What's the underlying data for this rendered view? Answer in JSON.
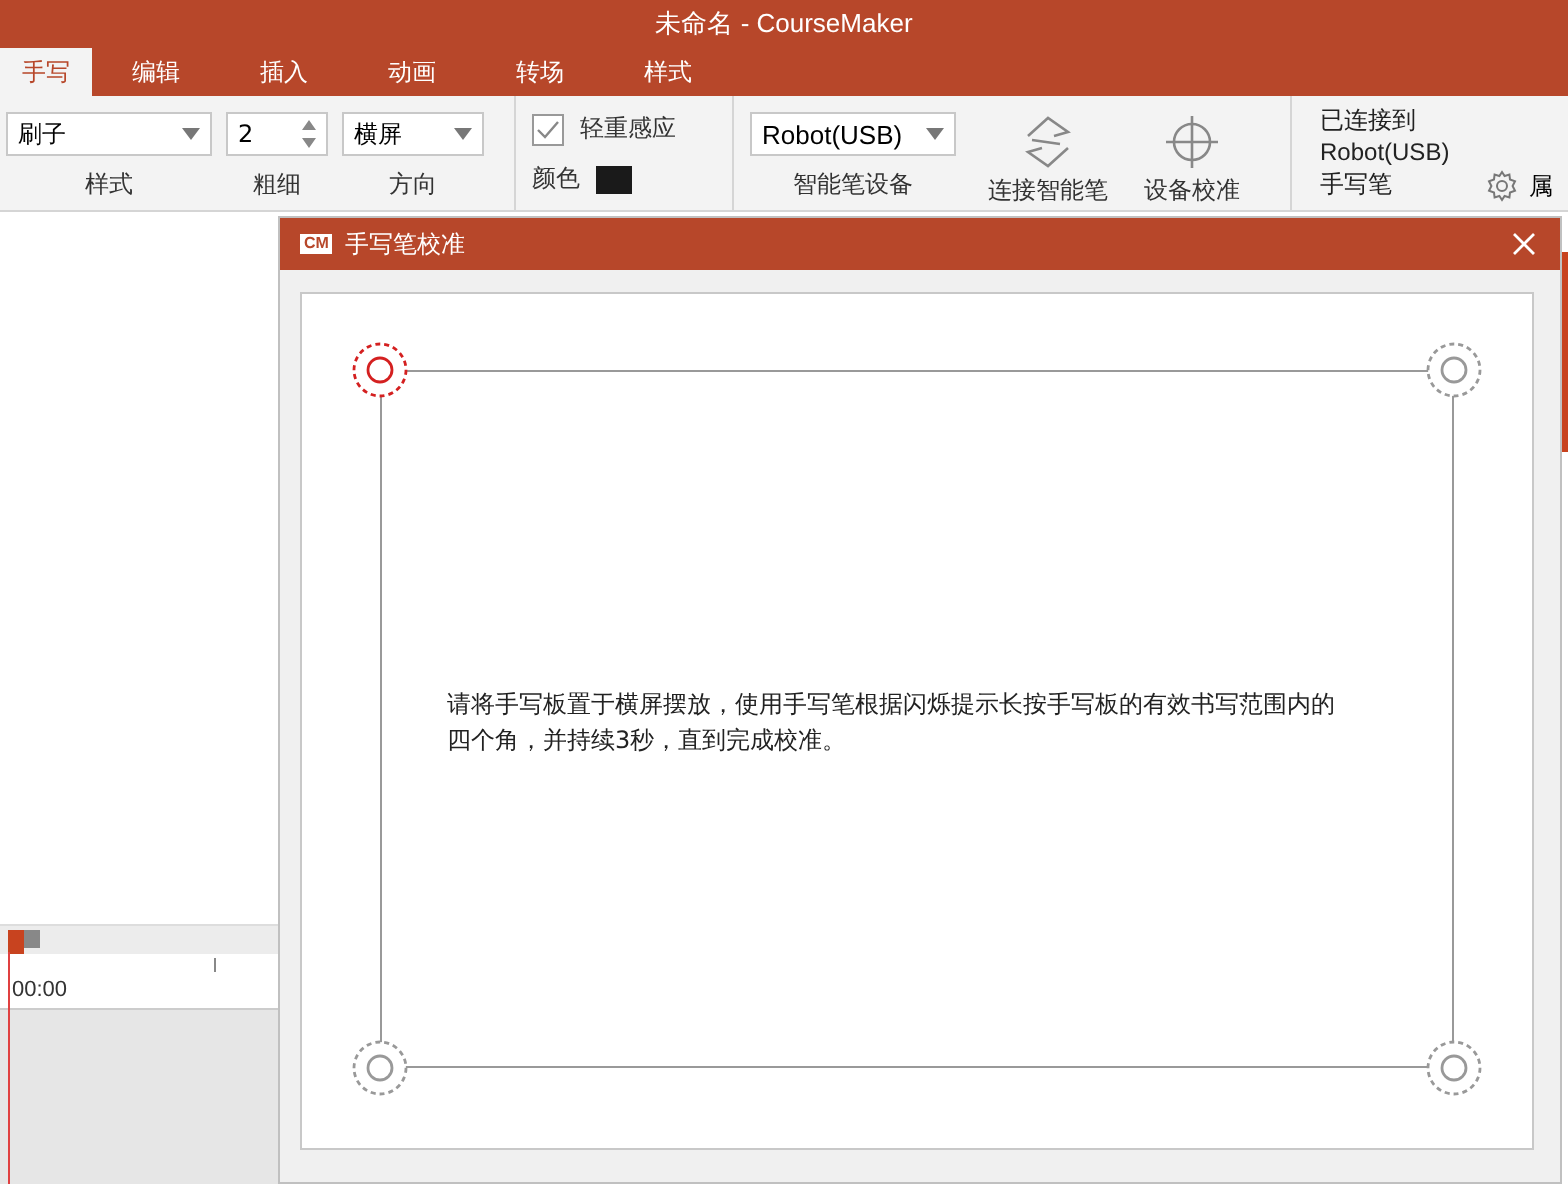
{
  "window": {
    "title": "未命名 - CourseMaker"
  },
  "tabs": [
    {
      "label": "手写",
      "selected": true
    },
    {
      "label": "编辑",
      "selected": false
    },
    {
      "label": "插入",
      "selected": false
    },
    {
      "label": "动画",
      "selected": false
    },
    {
      "label": "转场",
      "selected": false
    },
    {
      "label": "样式",
      "selected": false
    }
  ],
  "ribbon": {
    "selects": [
      {
        "value": "刷子",
        "label": "样式",
        "kind": "dropdown"
      },
      {
        "value": "2",
        "label": "粗细",
        "kind": "spinner"
      },
      {
        "value": "横屏",
        "label": "方向",
        "kind": "dropdown"
      }
    ],
    "pressure": {
      "label": "轻重感应",
      "checked": true
    },
    "pen_color": {
      "label": "颜色",
      "color": "#1a1a1a"
    },
    "device": {
      "value": "Robot(USB)",
      "label": "智能笔设备"
    },
    "buttons": [
      {
        "label": "连接智能笔",
        "kind": "connect"
      },
      {
        "label": "设备校准",
        "kind": "calibrate"
      }
    ],
    "status": [
      "已连接到",
      "Robot(USB)",
      "手写笔"
    ],
    "properties": {
      "label": "属"
    }
  },
  "timeline": {
    "time": "00:00"
  },
  "dialog": {
    "logo": "CM",
    "title": "手写笔校准",
    "instruction": "请将手写板置于横屏摆放，使用手写笔根据闪烁提示长按手写板的有效书写范围内的四个角，并持续3秒，直到完成校准。",
    "corners": [
      {
        "active": true
      },
      {
        "active": false
      },
      {
        "active": false
      },
      {
        "active": false
      }
    ]
  }
}
